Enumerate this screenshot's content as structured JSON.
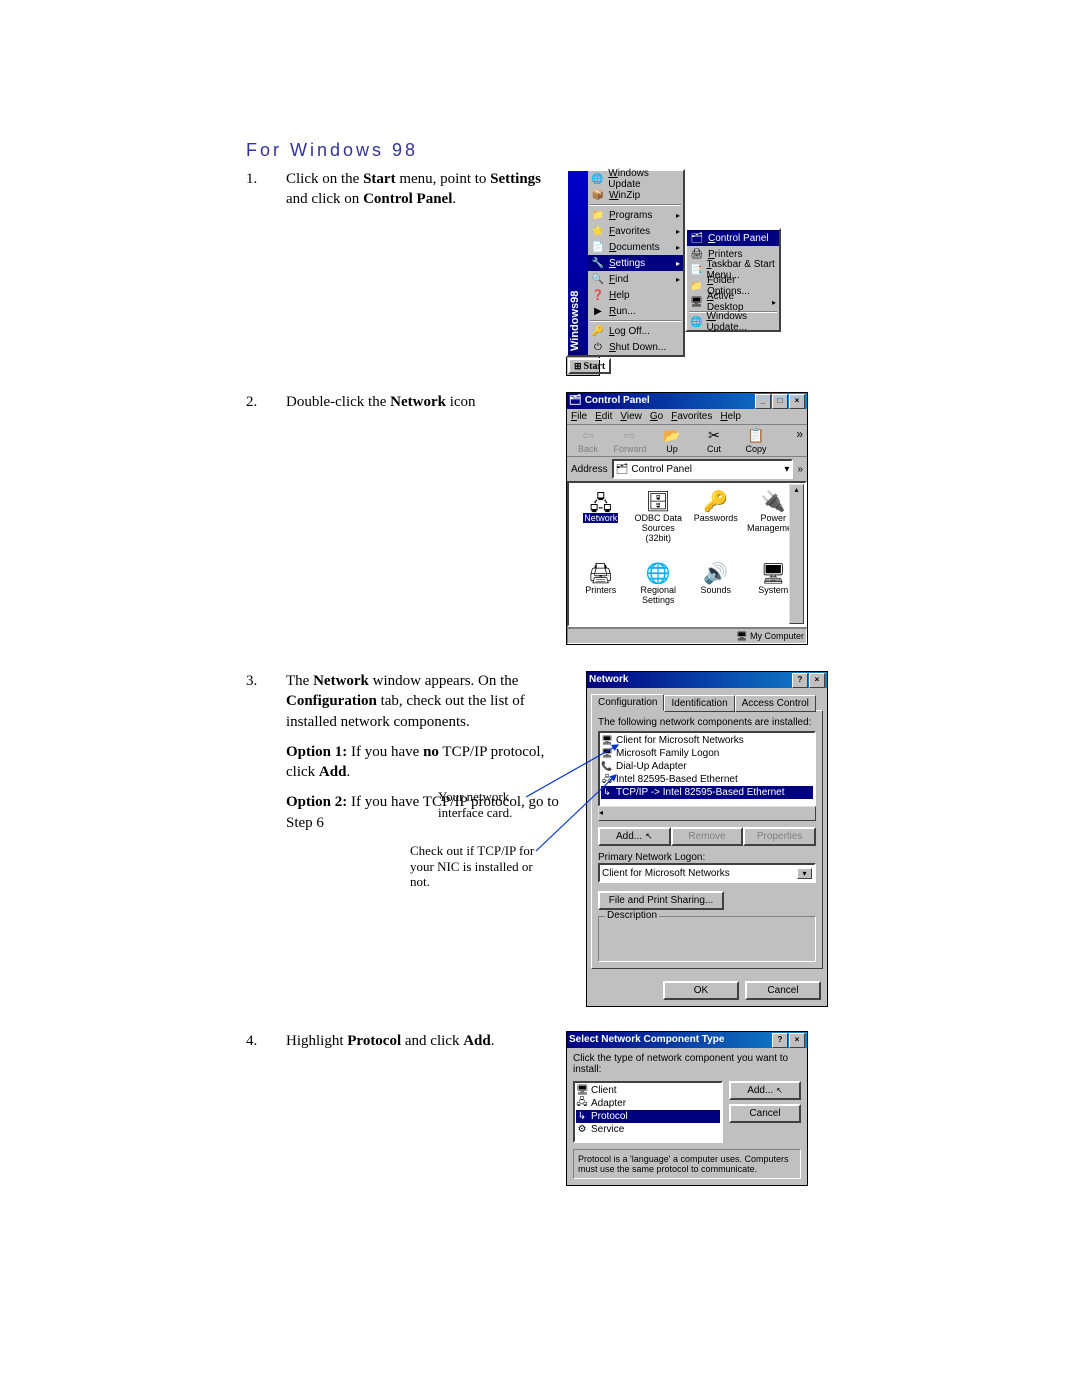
{
  "title": "For Windows 98",
  "steps": {
    "s1": {
      "num": "1.",
      "pre": "Click on the ",
      "b1": "Start",
      "mid1": " menu, point to ",
      "b2": "Settings",
      "mid2": " and click on ",
      "b3": "Control Panel",
      "end": "."
    },
    "s2": {
      "num": "2.",
      "pre": "Double-click the ",
      "b1": "Network",
      "end": " icon"
    },
    "s3": {
      "num": "3.",
      "l1_pre": "The ",
      "l1_b": "Network",
      "l1_post": " window appears. On the ",
      "l2_b": "Configuration",
      "l2_post": " tab, check out the list of installed network components.",
      "o1_b": "Option 1:",
      "o1_mid": " If you have ",
      "o1_b2": "no",
      "o1_post": " TCP/IP protocol, click ",
      "o1_b3": "Add",
      "o1_end": ".",
      "o2_b": "Option 2:",
      "o2_post": " If you have TCP/IP protocol, go to Step 6"
    },
    "s4": {
      "num": "4.",
      "pre": "Highlight ",
      "b1": "Protocol",
      "mid": " and click ",
      "b2": "Add",
      "end": "."
    }
  },
  "annot": {
    "nic": "Your network interface card.",
    "tcp": "Check out if TCP/IP for your NIC is installed or not."
  },
  "startmenu": {
    "items": [
      {
        "icon": "🌐",
        "label": "Windows Update"
      },
      {
        "icon": "📦",
        "label": "WinZip"
      },
      {
        "icon": "📁",
        "label": "Programs",
        "sub": true,
        "sep_before": true
      },
      {
        "icon": "⭐",
        "label": "Favorites",
        "sub": true
      },
      {
        "icon": "📄",
        "label": "Documents",
        "sub": true
      },
      {
        "icon": "🔧",
        "label": "Settings",
        "sub": true,
        "hi": true
      },
      {
        "icon": "🔍",
        "label": "Find",
        "sub": true
      },
      {
        "icon": "❓",
        "label": "Help"
      },
      {
        "icon": "▶",
        "label": "Run..."
      },
      {
        "icon": "🔑",
        "label": "Log Off...",
        "sep_before": true
      },
      {
        "icon": "⏻",
        "label": "Shut Down..."
      }
    ],
    "submenu": [
      {
        "icon": "🗂",
        "label": "Control Panel",
        "hi": true
      },
      {
        "icon": "🖨",
        "label": "Printers"
      },
      {
        "icon": "📑",
        "label": "Taskbar & Start Menu..."
      },
      {
        "icon": "📁",
        "label": "Folder Options..."
      },
      {
        "icon": "🖥",
        "label": "Active Desktop",
        "sub": true
      },
      {
        "icon": "🌐",
        "label": "Windows Update...",
        "sep_before": true
      }
    ],
    "start_label": "Start",
    "vbar": "Windows98"
  },
  "cp": {
    "title": "Control Panel",
    "menus": [
      "File",
      "Edit",
      "View",
      "Go",
      "Favorites",
      "Help"
    ],
    "tools": [
      {
        "g": "⇦",
        "l": "Back",
        "dis": true
      },
      {
        "g": "⇨",
        "l": "Forward",
        "dis": true
      },
      {
        "g": "📂",
        "l": "Up"
      },
      {
        "g": "✂",
        "l": "Cut"
      },
      {
        "g": "📋",
        "l": "Copy"
      }
    ],
    "addr_label": "Address",
    "addr_value": "Control Panel",
    "more": "»",
    "icons": [
      {
        "g": "🖧",
        "l": "Network",
        "sel": true
      },
      {
        "g": "🗄",
        "l": "ODBC Data Sources (32bit)"
      },
      {
        "g": "🔑",
        "l": "Passwords"
      },
      {
        "g": "🔌",
        "l": "Power Management"
      },
      {
        "g": "🖨",
        "l": "Printers"
      },
      {
        "g": "🌐",
        "l": "Regional Settings"
      },
      {
        "g": "🔊",
        "l": "Sounds"
      },
      {
        "g": "🖥",
        "l": "System"
      }
    ],
    "status": "My Computer"
  },
  "net": {
    "title": "Network",
    "tabs": [
      "Configuration",
      "Identification",
      "Access Control"
    ],
    "list_label": "The following network components are installed:",
    "components": [
      {
        "ic": "🖥",
        "t": "Client for Microsoft Networks"
      },
      {
        "ic": "🖥",
        "t": "Microsoft Family Logon"
      },
      {
        "ic": "📞",
        "t": "Dial-Up Adapter"
      },
      {
        "ic": "🖧",
        "t": "Intel 82595-Based Ethernet"
      },
      {
        "ic": "↳",
        "t": "TCP/IP -> Intel 82595-Based Ethernet",
        "hi": true
      }
    ],
    "btn_add": "Add...",
    "btn_remove": "Remove",
    "btn_prop": "Properties",
    "logon_label": "Primary Network Logon:",
    "logon_value": "Client for Microsoft Networks",
    "fps": "File and Print Sharing...",
    "desc": "Description",
    "ok": "OK",
    "cancel": "Cancel"
  },
  "sc": {
    "title": "Select Network Component Type",
    "prompt": "Click the type of network component you want to install:",
    "items": [
      {
        "ic": "🖥",
        "t": "Client"
      },
      {
        "ic": "🖧",
        "t": "Adapter"
      },
      {
        "ic": "↳",
        "t": "Protocol",
        "hi": true
      },
      {
        "ic": "⚙",
        "t": "Service"
      }
    ],
    "add": "Add...",
    "cancel": "Cancel",
    "help": "Protocol is a 'language' a computer uses. Computers must use the same protocol to communicate."
  }
}
